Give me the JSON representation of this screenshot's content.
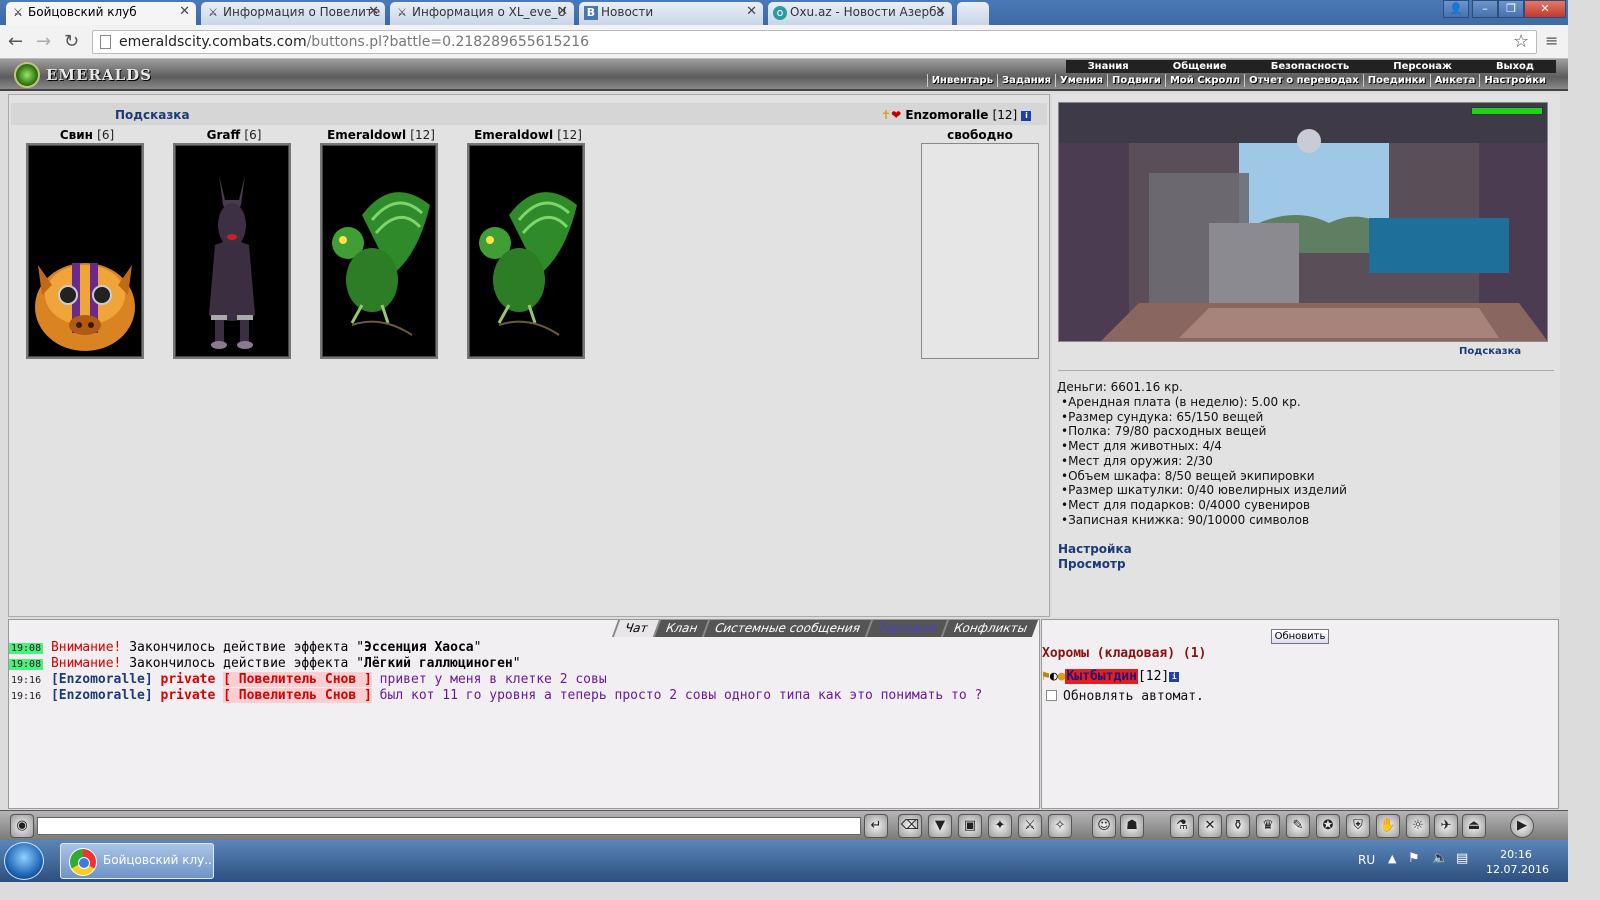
{
  "browser": {
    "tabs": [
      {
        "title": "Бойцовский клуб",
        "icon": "crossed-swords-icon"
      },
      {
        "title": "Информация о Повелите",
        "icon": "crossed-swords-icon"
      },
      {
        "title": "Информация о XL_eve_U",
        "icon": "crossed-swords-icon"
      },
      {
        "title": "Новости",
        "icon": "vk-icon"
      },
      {
        "title": "Oxu.az - Новости Азерба",
        "icon": "oxu-icon"
      }
    ],
    "url_host": "emeraldscity.combats.com",
    "url_path": "/buttons.pl?battle=0.218289655615216"
  },
  "game": {
    "logo": "EMERALDS",
    "main_menu": [
      "Знания",
      "Общение",
      "Безопасность",
      "Персонаж",
      "Выход"
    ],
    "sub_menu": [
      "Инвентарь",
      "Задания",
      "Умения",
      "Подвиги",
      "Мой Скролл",
      "Отчет о переводах",
      "Поединки",
      "Анкета",
      "Настройки"
    ],
    "hint": "Подсказка",
    "owner": {
      "name": "Enzomoralle",
      "level": "[12]"
    },
    "free_slot_label": "свободно",
    "pets": [
      {
        "name": "Свин",
        "level": "[6]",
        "kind": "pig"
      },
      {
        "name": "Graff",
        "level": "[6]",
        "kind": "dog"
      },
      {
        "name": "Emeraldowl",
        "level": "[12]",
        "kind": "owl"
      },
      {
        "name": "Emeraldowl",
        "level": "[12]",
        "kind": "owl"
      }
    ],
    "room_hint": "Подсказка",
    "money": "Деньги: 6601.16 кр.",
    "stats": [
      "Арендная плата (в неделю): 5.00 кр.",
      "Размер сундука: 65/150 вещей",
      "Полка: 79/80 расходных вещей",
      "Мест для животных: 4/4",
      "Мест для оружия: 2/30",
      "Объем шкафа: 8/50 вещей экипировки",
      "Размер шкатулки: 0/40 ювелирных изделий",
      "Мест для подарков: 0/4000 сувениров",
      "Записная книжка: 90/10000 символов"
    ],
    "link_settings": "Настройка",
    "link_view": "Просмотр"
  },
  "chat": {
    "tabs": [
      "Чат",
      "Клан",
      "Системные сообщения",
      "Торговля",
      "Конфликты"
    ],
    "messages": [
      {
        "time": "19:08",
        "prefix": "Внимание!",
        "text": " Закончилось действие эффекта \"",
        "effect": "Эссенция Хаоса",
        "suffix": "\""
      },
      {
        "time": "19:08",
        "prefix": "Внимание!",
        "text": " Закончилось действие эффекта \"",
        "effect": "Лёгкий галлюциноген",
        "suffix": "\""
      },
      {
        "time": "19:16",
        "nick": "[Enzomoralle]",
        "private": "private",
        "target": "[ Повелитель Снов ]",
        "text": " привет у меня в клетке 2 совы"
      },
      {
        "time": "19:16",
        "nick": "[Enzomoralle]",
        "private": "private",
        "target": "[ Повелитель Снов ]",
        "text": " был кот 11 го уровня а теперь просто 2 совы одного типа как это понимать то ?"
      }
    ]
  },
  "users": {
    "refresh": "Обновить",
    "room_title": "Хоромы (кладовая) (1)",
    "user_name": "Кытбытдин",
    "user_level": "[12]",
    "auto_update": "Обновлять автомат."
  },
  "taskbar": {
    "item": "Бойцовский клу...",
    "lang": "RU",
    "time": "20:16",
    "date": "12.07.2016"
  }
}
